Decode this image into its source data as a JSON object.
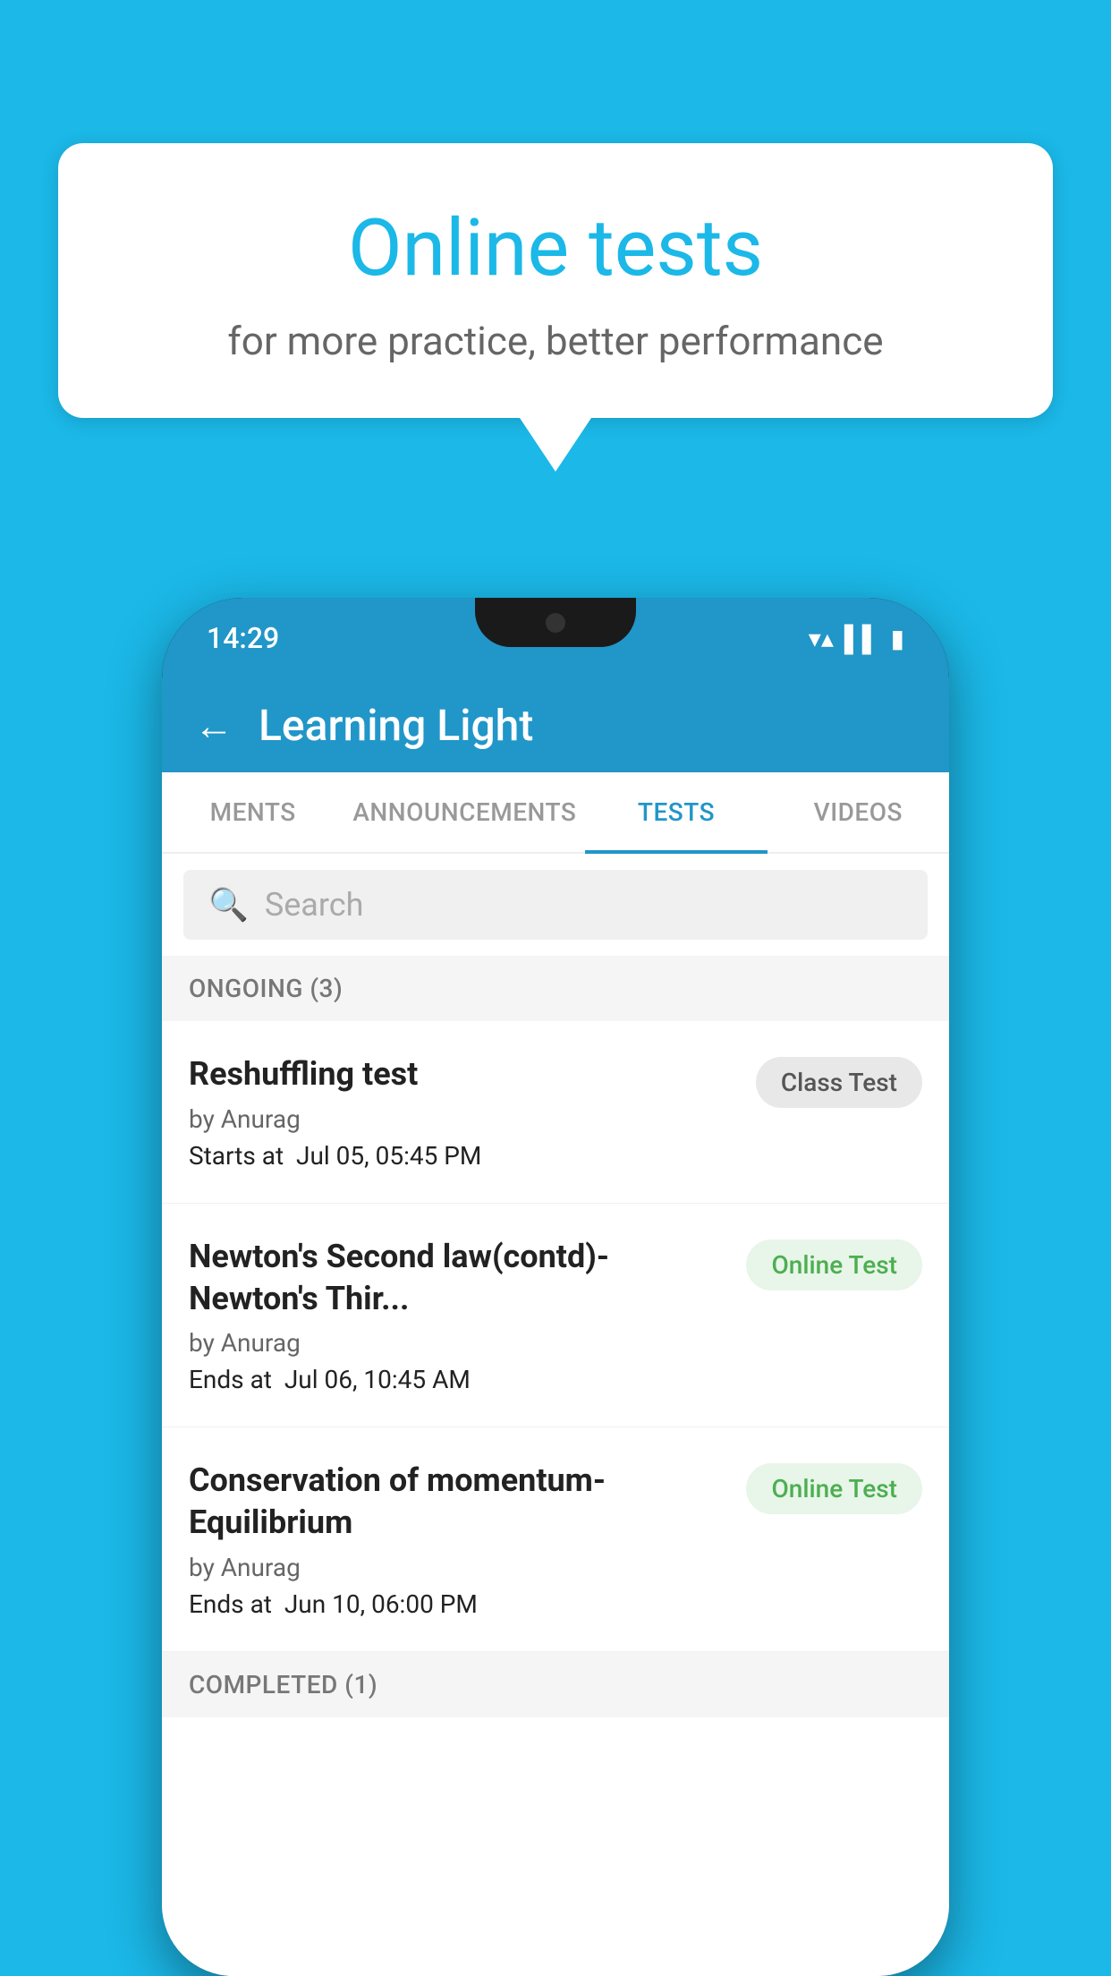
{
  "background": {
    "color": "#1BB8E8"
  },
  "speech_bubble": {
    "title": "Online tests",
    "subtitle": "for more practice, better performance"
  },
  "phone": {
    "status_bar": {
      "time": "14:29",
      "wifi_icon": "▼",
      "signal_icon": "▲",
      "battery_icon": "▮"
    },
    "app_header": {
      "back_label": "←",
      "title": "Learning Light"
    },
    "tabs": [
      {
        "label": "MENTS",
        "active": false
      },
      {
        "label": "ANNOUNCEMENTS",
        "active": false
      },
      {
        "label": "TESTS",
        "active": true
      },
      {
        "label": "VIDEOS",
        "active": false
      }
    ],
    "search": {
      "placeholder": "Search"
    },
    "ongoing_section": {
      "label": "ONGOING (3)"
    },
    "tests": [
      {
        "name": "Reshuffling test",
        "author": "by Anurag",
        "time_label": "Starts at",
        "time_value": "Jul 05, 05:45 PM",
        "badge": "Class Test",
        "badge_type": "class"
      },
      {
        "name": "Newton's Second law(contd)-Newton's Thir...",
        "author": "by Anurag",
        "time_label": "Ends at",
        "time_value": "Jul 06, 10:45 AM",
        "badge": "Online Test",
        "badge_type": "online"
      },
      {
        "name": "Conservation of momentum-Equilibrium",
        "author": "by Anurag",
        "time_label": "Ends at",
        "time_value": "Jun 10, 06:00 PM",
        "badge": "Online Test",
        "badge_type": "online"
      }
    ],
    "completed_section": {
      "label": "COMPLETED (1)"
    }
  }
}
